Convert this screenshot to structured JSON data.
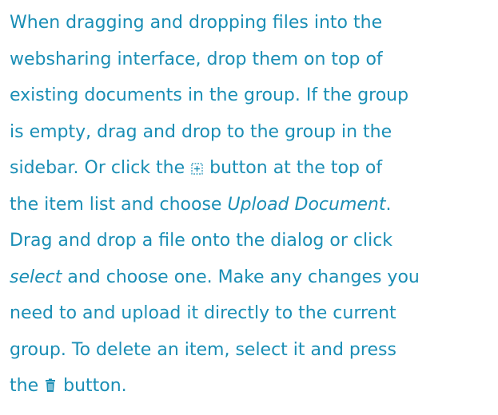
{
  "paragraph": {
    "line1": "When dragging and dropping files into the",
    "line2": "websharing interface, drop them on top of",
    "line3": "existing documents in the group. If the group",
    "line4": "is empty, drag and drop to the group in the",
    "line5_before_icon": "sidebar. Or click the ",
    "line5_after_icon": " button at the top of",
    "line6_before_em": "the item list and choose ",
    "line6_em": "Upload Document",
    "line6_after_em": ".",
    "line7": "Drag and drop a file onto the dialog or click",
    "line8_em": "select",
    "line8_after_em": " and choose one. Make any changes you",
    "line9": "need to and upload it directly to the current",
    "line10": "group. To delete an item, select it and press",
    "line11_before_icon": "the ",
    "line11_after_icon": " button."
  },
  "icons": {
    "add": "add-square-icon",
    "delete": "trash-icon"
  },
  "colors": {
    "text": "#1a8eb5"
  }
}
